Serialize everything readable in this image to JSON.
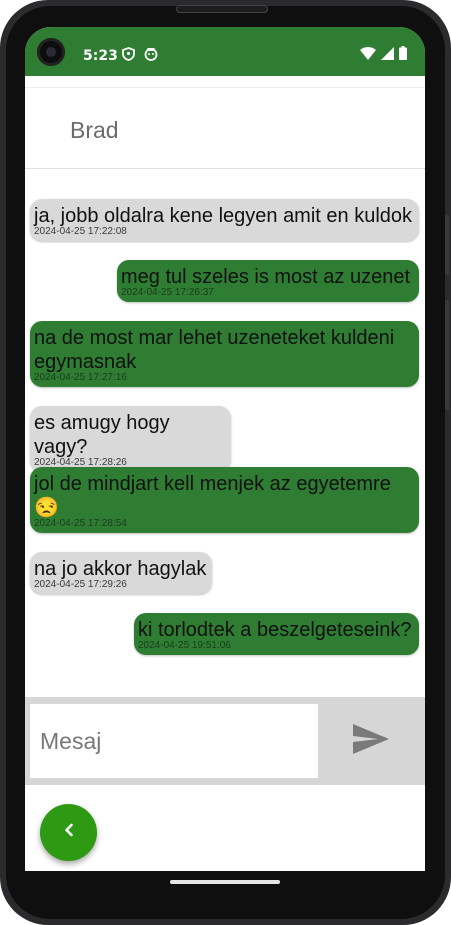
{
  "status_bar": {
    "time": "5:23",
    "icons": [
      "shield-icon",
      "robot-icon",
      "wifi-icon",
      "signal-icon",
      "battery-icon"
    ],
    "color": "#2e7d32"
  },
  "header": {
    "contact_name": "Brad"
  },
  "messages": [
    {
      "direction": "in",
      "text": "ja, jobb oldalra kene legyen amit en kuldok",
      "time": "2024-04-25 17:22:08"
    },
    {
      "direction": "out",
      "text": "meg tul szeles is most az uzenet",
      "time": "2024-04-25 17:26:37"
    },
    {
      "direction": "out",
      "text": "na de most mar lehet uzeneteket kuldeni egymasnak",
      "time": "2024-04-25 17:27:16"
    },
    {
      "direction": "in",
      "text": "es amugy hogy vagy?",
      "time": "2024-04-25 17:28:26"
    },
    {
      "direction": "out",
      "text": "jol de mindjart kell menjek az egyetemre 😒",
      "time": "2024-04-25 17:28:54"
    },
    {
      "direction": "in",
      "text": "na jo akkor hagylak",
      "time": "2024-04-25 17:29:26"
    },
    {
      "direction": "out",
      "text": "ki torlodtek a beszelgeteseink?",
      "time": "2024-04-25 19:51:06"
    }
  ],
  "composer": {
    "placeholder": "Mesaj",
    "value": "",
    "send_icon": "send-icon"
  },
  "fab": {
    "icon": "chevron-left-icon",
    "color": "#2e9a14"
  },
  "colors": {
    "incoming_bubble": "#d9d9d9",
    "outgoing_bubble": "#2e7d32"
  }
}
